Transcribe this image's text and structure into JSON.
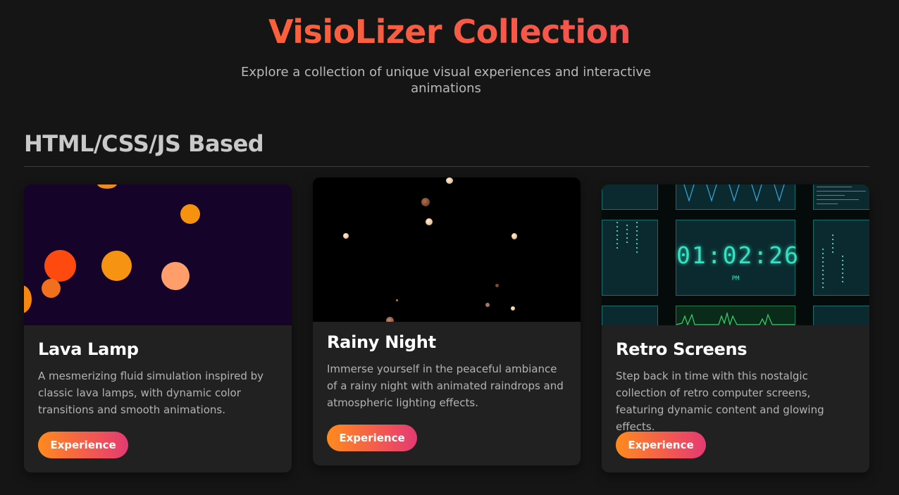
{
  "header": {
    "title": "VisioLizer Collection",
    "subtitle": "Explore a collection of unique visual experiences and interactive animations"
  },
  "section": {
    "title": "HTML/CSS/JS Based"
  },
  "cards": [
    {
      "title": "Lava Lamp",
      "description": "A mesmerizing fluid simulation inspired by classic lava lamps, with dynamic color transitions and smooth animations.",
      "button": "Experience"
    },
    {
      "title": "Rainy Night",
      "description": "Immerse yourself in the peaceful ambiance of a rainy night with animated raindrops and atmospheric lighting effects.",
      "button": "Experience"
    },
    {
      "title": "Retro Screens",
      "description": "Step back in time with this nostalgic collection of retro computer screens, featuring dynamic content and glowing effects.",
      "button": "Experience",
      "preview_clock": "01:02:26",
      "preview_ampm": "PM"
    }
  ],
  "colors": {
    "background": "#151515",
    "card": "#212121",
    "accent_start": "#ff8a1e",
    "accent_end": "#e23a72",
    "lava_bg": "#15032a",
    "retro_glow": "#38e0c2"
  }
}
